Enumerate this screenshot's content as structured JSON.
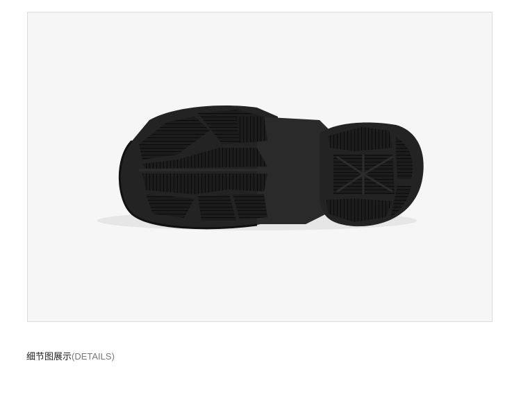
{
  "caption": {
    "title_cn": "细节图展示",
    "title_en": "(DETAILS)"
  },
  "colors": {
    "frame_border": "#dcdcdc",
    "frame_bg": "#f6f6f6",
    "sole_dark": "#1c1c1c",
    "sole_mid": "#2b2b2b",
    "sole_tread": "#0f0f0f"
  }
}
